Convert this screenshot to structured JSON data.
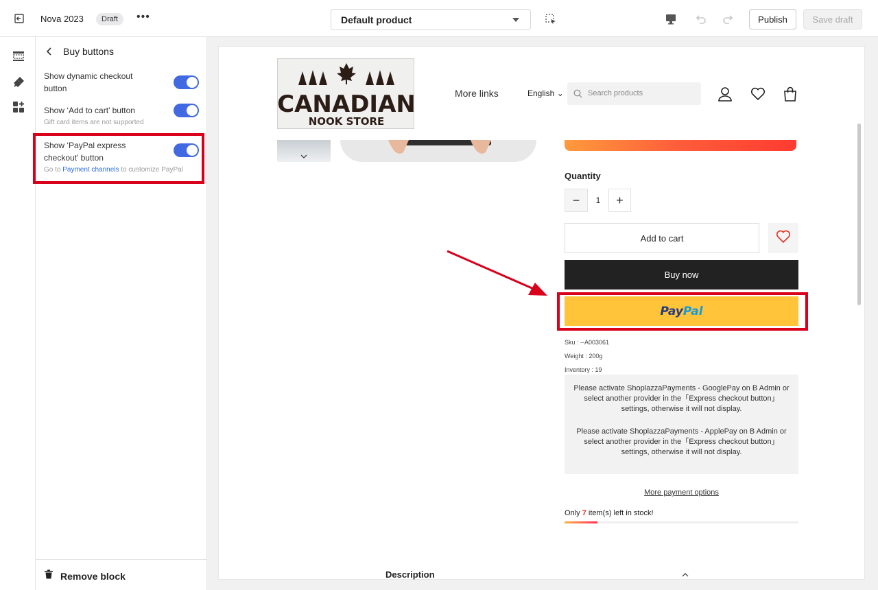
{
  "topbar": {
    "theme_name": "Nova 2023",
    "status_badge": "Draft",
    "more_glyph": "•••",
    "template_select": "Default product",
    "publish_label": "Publish",
    "save_draft_label": "Save draft"
  },
  "panel": {
    "title": "Buy buttons",
    "settings": [
      {
        "label": "Show dynamic checkout button",
        "enabled": true,
        "hint": ""
      },
      {
        "label": "Show ‘Add to cart’ button",
        "enabled": true,
        "hint": "Gift card items are not supported"
      },
      {
        "label": "Show ‘PayPal express checkout’ button",
        "enabled": true,
        "hint_prefix": "Go to ",
        "hint_link": "Payment channels",
        "hint_suffix": " to customize PayPal"
      }
    ],
    "remove_block_label": "Remove block"
  },
  "storefront": {
    "logo_line1": "CANADIAN",
    "logo_line2": "NOOK STORE",
    "nav_more_links": "More links",
    "language": "English",
    "search_placeholder": "Search products",
    "quantity_label": "Quantity",
    "quantity_value": "1",
    "add_to_cart": "Add to cart",
    "buy_now": "Buy now",
    "paypal_part1": "Pay",
    "paypal_part2": "Pal",
    "sku": "Sku : --A003061",
    "weight": "Weight : 200g",
    "inventory": "Inventory : 19",
    "notice_google": "Please activate ShoplazzaPayments - GooglePay on B Admin or select another provider in the「Express checkout button」 settings, otherwise it will not display.",
    "notice_apple": "Please activate ShoplazzaPayments - ApplePay on B Admin or select another provider in the「Express checkout button」 settings, otherwise it will not display.",
    "more_payment_options": "More payment options",
    "stock_prefix": "Only ",
    "stock_count": "7",
    "stock_suffix": " item(s) left in stock!",
    "stock_fill_fraction": 0.14,
    "description_label": "Description"
  },
  "colors": {
    "accent_toggle": "#4169e1",
    "highlight": "#d9001b",
    "paypal_yellow": "#ffc439",
    "paypal_navy": "#253b80",
    "paypal_blue": "#179bd7"
  },
  "icons": [
    "exit-icon",
    "inspect-icon",
    "desktop-icon",
    "undo-icon",
    "redo-icon",
    "sections-icon",
    "theme-style-icon",
    "apps-icon",
    "back-icon",
    "trash-icon",
    "search-icon",
    "user-icon",
    "heart-icon",
    "bag-icon",
    "chevron-up-icon"
  ]
}
